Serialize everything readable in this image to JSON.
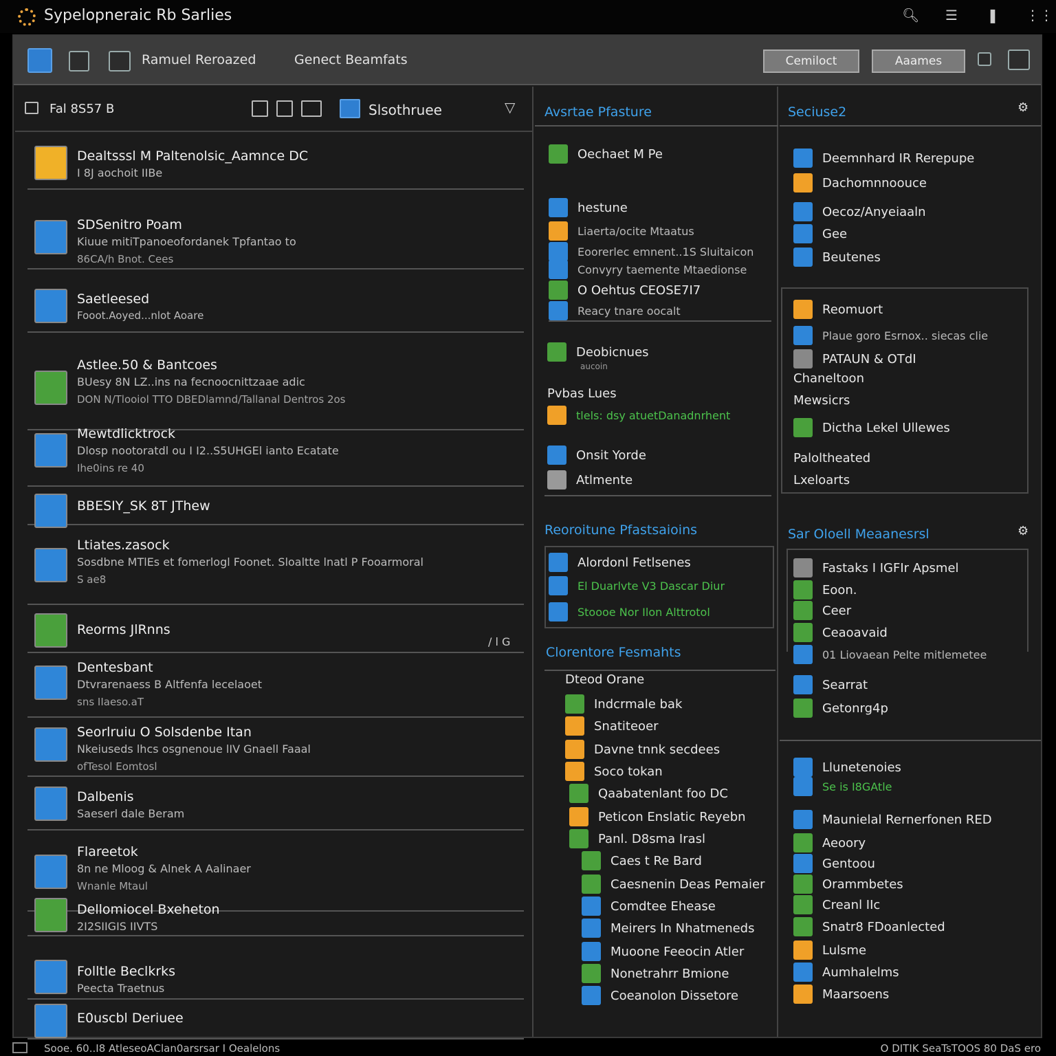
{
  "app": {
    "title": "Sypelopneraic Rb Sarlies"
  },
  "titlebar_icons": [
    "search-icon",
    "list-icon",
    "pin-icon",
    "more-icon"
  ],
  "toolbar": {
    "label1": "Ramuel Reroazed",
    "label2": "Genect Beamfats",
    "btn1": "Cemiloct",
    "btn2": "Aaames"
  },
  "left": {
    "header_text": "Fal 8S57 B",
    "header_title": "Slsothruee",
    "items": [
      {
        "title": "Dealtsssl M Paltenolsic_Aamnce DC",
        "sub": "I 8J aochoit IIBe",
        "sub2": "",
        "color": "#f0b128"
      },
      {
        "title": "SDSenitro Poam",
        "sub": "Kiuue mitiTpanoeofordanek Tpfantao to",
        "sub2": "86CA/h Bnot. Cees",
        "color": "#2f86d8"
      },
      {
        "title": "Saetleesed",
        "sub": "Fooot.Aoyed...nlot Aoare",
        "sub2": "",
        "color": "#2f86d8"
      },
      {
        "title": "Astlee.50 & Bantcoes",
        "sub": "BUesy 8N LZ..ins na fecnoocnittzaae adic",
        "sub2": "DON N/Tlooiol TTO DBEDlamnd/Tallanal Dentros 2os",
        "color": "#4aa03c"
      },
      {
        "title": "Mewtdlicktrock",
        "sub": "Dlosp nootoratdl ou I I2..S5UHGEl ianto Ecatate",
        "sub2": "Ihe0ins re 40",
        "color": "#2f86d8"
      },
      {
        "title": "BBESIY_SK 8T JThew",
        "sub": "",
        "sub2": "",
        "color": "#2f86d8"
      },
      {
        "title": "Ltiates.zasock",
        "sub": "Sosdbne MTlEs et fomerlogl Foonet.  Sloaltte lnatl P Fooarmoral",
        "sub2": "S ae8",
        "color": "#2f86d8"
      },
      {
        "title": "Reorms JlRnns",
        "sub": "",
        "sub2": "",
        "color": "#4aa03c"
      },
      {
        "title": "Dentesbant",
        "sub": "Dtvrarenaess B Altfenfa lecelaoet",
        "sub2": "sns  IIaeso.aT",
        "color": "#2f86d8"
      },
      {
        "title": "Seorlruiu O Solsdenbe Itan",
        "sub": "Nkeiuseds lhcs osgnenoue lIV Gnaell Faaal",
        "sub2": "ofTesol  Eomtosl",
        "color": "#2f86d8"
      },
      {
        "title": "Dalbenis",
        "sub": "Saeserl dale  Beram",
        "sub2": "",
        "color": "#2f86d8"
      },
      {
        "title": "Flareetok",
        "sub": "8n ne Mloog & Alnek A Aalinaer",
        "sub2": "Wnanle Mtaul",
        "color": "#2f86d8"
      },
      {
        "title": "Dellomiocel Bxeheton",
        "sub": "2I2SIIGIS IIVTS",
        "sub2": "",
        "color": "#4aa03c"
      },
      {
        "title": "Folltle Beclkrks",
        "sub": "Peecta Traetnus",
        "sub2": "",
        "color": "#2f86d8"
      },
      {
        "title": "E0uscbl Deriuee",
        "sub": "",
        "sub2": "",
        "color": "#2f86d8"
      }
    ],
    "right_note": "/ l G"
  },
  "mid": {
    "h1": "Avsrtae Pfasture",
    "rows1": [
      {
        "t": "Oechaet M Pe",
        "color": "#4aa03c"
      },
      {
        "t": "hestune",
        "color": "#2f86d8"
      },
      {
        "t": "Liaerta/ocite Mtaatus",
        "color": "#f0a028"
      },
      {
        "t": "Eoorerlec emnent..1S Sluitaicon",
        "color": "#2f86d8"
      },
      {
        "t": "Convyry taemente Mtaedionse",
        "color": "#2f86d8"
      },
      {
        "t": "O Oehtus CEOSE7I7",
        "color": "#4aa03c"
      },
      {
        "t": "Reacy tnare oocalt",
        "color": "#2f86d8"
      }
    ],
    "rows2": [
      {
        "t": "Deobicnues",
        "sub": "aucoin",
        "color": "#4aa03c"
      },
      {
        "t": "Pvbas Lues",
        "color": ""
      },
      {
        "t": "tlels: dsy atuetDanadnrhent",
        "color": "#f0a028"
      },
      {
        "t": "Onsit Yorde",
        "color": "#2f86d8"
      },
      {
        "t": "Atlmente",
        "color": "#999"
      }
    ],
    "h2": "Reoroitune Pfastsaioins",
    "rows3": [
      {
        "t": "Alordonl Fetlsenes",
        "color": "#2f86d8"
      },
      {
        "t": "El Duarlvte V3 Dascar Diur",
        "color": "#2f86d8"
      },
      {
        "t": "Stoooe Nor Ilon Alttrotol",
        "color": "#2f86d8"
      }
    ],
    "h3": "Clorentore Fesmahts",
    "rows4": [
      {
        "t": "Dteod Orane",
        "color": ""
      },
      {
        "t": "Indcrmale bak",
        "color": "#4aa03c"
      },
      {
        "t": "Snatiteoer",
        "color": "#f0a028"
      },
      {
        "t": "Davne tnnk secdees",
        "color": "#f0a028"
      },
      {
        "t": "Soco tokan",
        "color": "#f0a028"
      },
      {
        "t": "Qaabatenlant foo DC",
        "color": "#4aa03c"
      },
      {
        "t": "Peticon Enslatic Reyebn",
        "color": "#f0a028"
      },
      {
        "t": "Panl. D8sma Irasl",
        "color": "#4aa03c"
      },
      {
        "t": "Caes t Re Bard",
        "color": "#4aa03c"
      },
      {
        "t": "Caesnenin Deas Pemaier",
        "color": "#4aa03c"
      },
      {
        "t": "Comdtee Ehease",
        "color": "#2f86d8"
      },
      {
        "t": "Meirers In Nhatmeneds",
        "color": "#2f86d8"
      },
      {
        "t": "Muoone Feeocin Atler",
        "color": "#2f86d8"
      },
      {
        "t": "Nonetrahrr Bmione",
        "color": "#4aa03c"
      },
      {
        "t": "Coeanolon Dissetore",
        "color": "#2f86d8"
      }
    ]
  },
  "right": {
    "h1": "Seciuse2",
    "rows1": [
      {
        "t": "Deemnhard IR Rerepupe",
        "color": "#2f86d8"
      },
      {
        "t": "Dachomnnoouce",
        "color": "#f0a028"
      },
      {
        "t": "Oecoz/Anyeiaaln",
        "color": "#2f86d8"
      },
      {
        "t": "Gee",
        "color": "#2f86d8"
      },
      {
        "t": "Beutenes",
        "color": "#2f86d8"
      }
    ],
    "rows2": [
      {
        "t": "Reomuort",
        "color": "#f0a028"
      },
      {
        "t": "Plaue goro Esrnox.. siecas clie",
        "color": "#2f86d8"
      },
      {
        "t": "PATAUN & OTdI",
        "color": "#888"
      },
      {
        "t": "Chaneltoon",
        "color": ""
      },
      {
        "t": "Mewsicrs",
        "color": ""
      },
      {
        "t": "Dictha Lekel Ullewes",
        "color": "#4aa03c"
      },
      {
        "t": "Paloltheated",
        "color": ""
      },
      {
        "t": "Lxeloarts",
        "color": ""
      }
    ],
    "h2": "Sar Oloell Meaanesrsl",
    "rows3": [
      {
        "t": "Fastaks I IGFIr Apsmel",
        "color": "#888"
      },
      {
        "t": "Eoon.",
        "color": "#4aa03c"
      },
      {
        "t": "Ceer",
        "color": "#4aa03c"
      },
      {
        "t": "Ceaoavaid",
        "color": "#4aa03c"
      },
      {
        "t": "01 Liovaean Pelte mitlemetee",
        "color": "#2f86d8"
      },
      {
        "t": "Searrat",
        "color": "#2f86d8"
      },
      {
        "t": "Getonrg4p",
        "color": "#4aa03c"
      }
    ],
    "rows4": [
      {
        "t": "Llunetenoies",
        "color": "#2f86d8"
      },
      {
        "t": "Se is  I8GAtle",
        "color": "#2f86d8"
      },
      {
        "t": "Maunielal Rernerfonen RED",
        "color": "#2f86d8"
      },
      {
        "t": "Aeoory",
        "color": "#4aa03c"
      },
      {
        "t": "Gentoou",
        "color": "#2f86d8"
      },
      {
        "t": "Orammbetes",
        "color": "#4aa03c"
      },
      {
        "t": "Creanl IIc",
        "color": "#4aa03c"
      },
      {
        "t": "Snatr8 FDoanlected",
        "color": "#4aa03c"
      },
      {
        "t": "Lulsme",
        "color": "#f0a028"
      },
      {
        "t": "Aumhalelms",
        "color": "#2f86d8"
      },
      {
        "t": "Maarsoens",
        "color": "#f0a028"
      }
    ]
  },
  "status": {
    "left": "Sooe. 60..I8 AtleseoAClan0arsrsar I Oealelons",
    "right": "O DITIK SeaTsTOOS 80 DaS ero"
  }
}
